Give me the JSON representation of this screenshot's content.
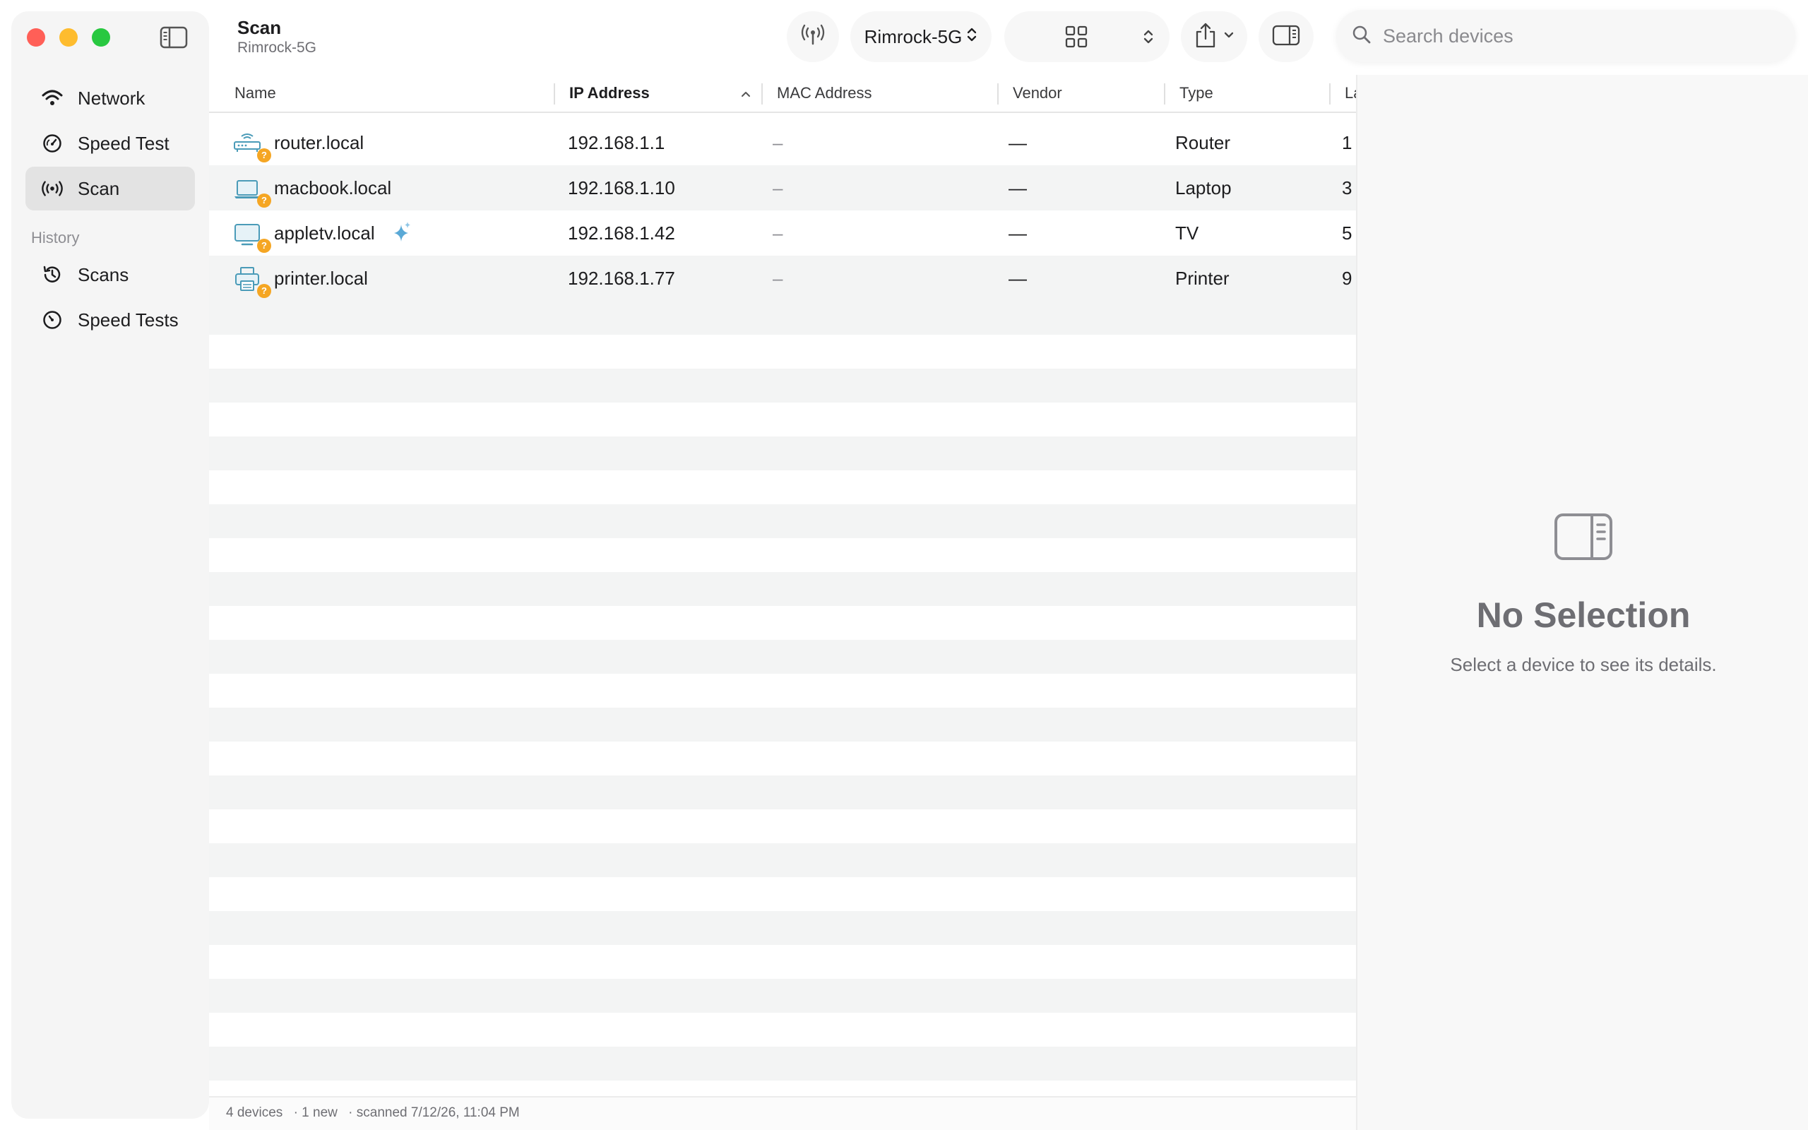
{
  "header": {
    "title": "Scan",
    "subtitle": "Rimrock-5G",
    "ssid_label": "Rimrock-5G"
  },
  "search": {
    "placeholder": "Search devices"
  },
  "sidebar": {
    "items": [
      {
        "label": "Network",
        "icon": "wifi-icon"
      },
      {
        "label": "Speed Test",
        "icon": "gauge-icon"
      },
      {
        "label": "Scan",
        "icon": "broadcast-icon",
        "active": true
      }
    ],
    "history_label": "History",
    "history_items": [
      {
        "label": "Scans",
        "icon": "history-icon"
      },
      {
        "label": "Speed Tests",
        "icon": "clock-icon"
      }
    ]
  },
  "table": {
    "columns": [
      "Name",
      "IP Address",
      "MAC Address",
      "Vendor",
      "Type",
      "La"
    ],
    "sorted_column": "IP Address",
    "rows": [
      {
        "name": "router.local",
        "ip": "192.168.1.1",
        "mac": "–",
        "vendor": "—",
        "type": "Router",
        "last": "1",
        "icon": "router-icon",
        "badge": "?"
      },
      {
        "name": "macbook.local",
        "ip": "192.168.1.10",
        "mac": "–",
        "vendor": "—",
        "type": "Laptop",
        "last": "3",
        "icon": "laptop-icon",
        "badge": "?"
      },
      {
        "name": "appletv.local",
        "ip": "192.168.1.42",
        "mac": "–",
        "vendor": "—",
        "type": "TV",
        "last": "5",
        "icon": "tv-icon",
        "badge": "?",
        "new": true
      },
      {
        "name": "printer.local",
        "ip": "192.168.1.77",
        "mac": "–",
        "vendor": "—",
        "type": "Printer",
        "last": "9",
        "icon": "printer-icon",
        "badge": "?"
      }
    ]
  },
  "footer": {
    "devices": "4 devices",
    "new": "· 1 new",
    "scanned": "· scanned 7/12/26, 11:04 PM"
  },
  "inspector": {
    "title": "No Selection",
    "subtitle": "Select a device to see its details."
  },
  "colors": {
    "close": "#ff5f57",
    "minimize": "#febc2e",
    "zoom": "#28c840",
    "badge": "#f5a623",
    "accent_icon": "#4a9bb8"
  }
}
